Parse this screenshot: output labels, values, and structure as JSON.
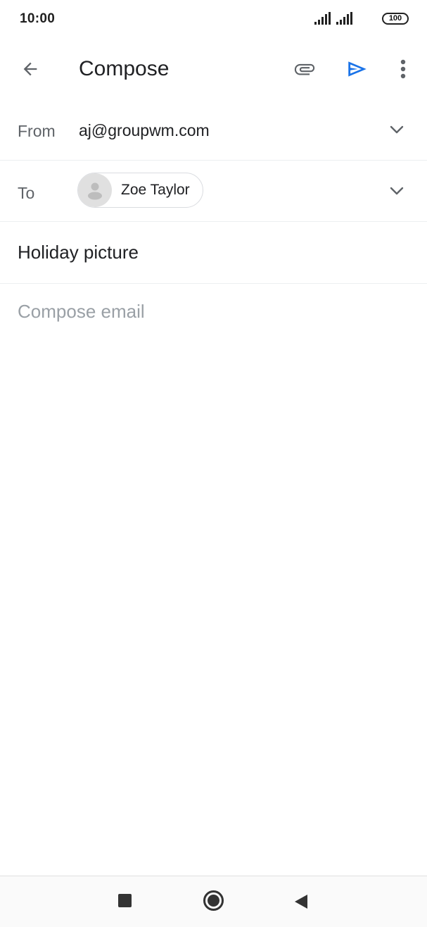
{
  "status_bar": {
    "time": "10:00",
    "battery": "100",
    "icons": [
      "signal-icon",
      "signal-icon",
      "battery-icon"
    ]
  },
  "app_bar": {
    "title": "Compose",
    "icons": [
      "back-arrow-icon",
      "paperclip-icon",
      "send-icon",
      "more-vert-icon"
    ],
    "accent_color": "#1a73e8"
  },
  "from": {
    "label": "From",
    "value": "aj@groupwm.com"
  },
  "to": {
    "label": "To",
    "recipients": [
      {
        "name": "Zoe Taylor"
      }
    ]
  },
  "subject": {
    "value": "Holiday picture"
  },
  "body": {
    "placeholder": "Compose email"
  },
  "nav_bar": {
    "icons": [
      "recents-square-icon",
      "home-circle-icon",
      "back-triangle-icon"
    ]
  }
}
